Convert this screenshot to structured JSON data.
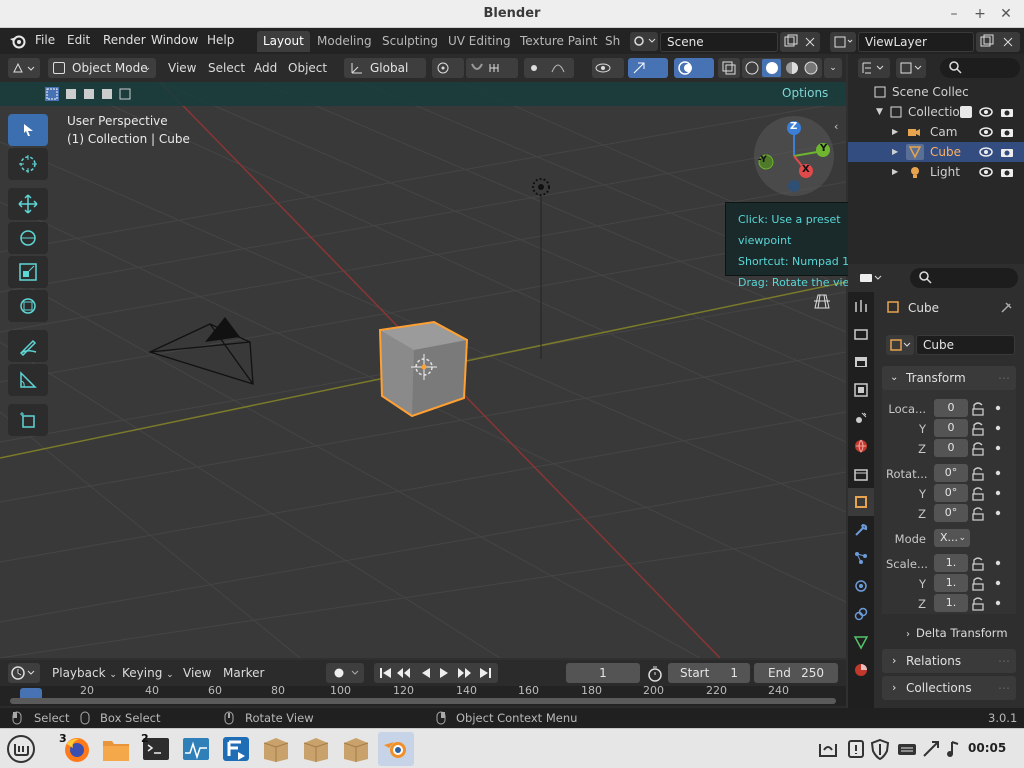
{
  "window": {
    "title": "Blender"
  },
  "menu": {
    "file": "File",
    "edit": "Edit",
    "render": "Render",
    "window": "Window",
    "help": "Help"
  },
  "workspaces": [
    "Layout",
    "Modeling",
    "Sculpting",
    "UV Editing",
    "Texture Paint",
    "Sh"
  ],
  "scene": {
    "name": "Scene",
    "view_layer": "ViewLayer"
  },
  "viewport_header": {
    "mode": "Object Mode",
    "view": "View",
    "select": "Select",
    "add": "Add",
    "object": "Object",
    "orientation": "Global",
    "options": "Options"
  },
  "viewport": {
    "perspective": "User Perspective",
    "context": "(1) Collection | Cube",
    "gizmo": {
      "z": "Z",
      "y": "Y",
      "x": "X",
      "neg_y": "-Y"
    }
  },
  "tooltip": {
    "line1": "Click: Use a preset viewpoint",
    "line2": "Shortcut: Numpad 1",
    "line3": "Drag: Rotate the view"
  },
  "outliner": {
    "root": "Scene Collec",
    "collection": "Collectio",
    "items": [
      {
        "label": "Cam",
        "selected": false
      },
      {
        "label": "Cube",
        "selected": true
      },
      {
        "label": "Light",
        "selected": false
      }
    ]
  },
  "properties": {
    "object_name": "Cube",
    "data_name": "Cube",
    "transform": "Transform",
    "location_label": "Loca...",
    "location": {
      "x": "0",
      "y": "0",
      "z": "0"
    },
    "rotation_label": "Rotat...",
    "rotation": {
      "x": "0°",
      "y": "0°",
      "z": "0°"
    },
    "mode_label": "Mode",
    "mode_value": "X...",
    "scale_label": "Scale...",
    "scale": {
      "x": "1.",
      "y": "1.",
      "z": "1."
    },
    "axis_y": "Y",
    "axis_z": "Z",
    "delta_transform": "Delta Transform",
    "relations": "Relations",
    "collections": "Collections"
  },
  "timeline": {
    "playback": "Playback",
    "keying": "Keying",
    "view": "View",
    "marker": "Marker",
    "current_frame": "1",
    "start_label": "Start",
    "start": "1",
    "end_label": "End",
    "end": "250",
    "ticks": [
      "20",
      "40",
      "60",
      "80",
      "100",
      "120",
      "140",
      "160",
      "180",
      "200",
      "220",
      "240"
    ]
  },
  "status": {
    "select": "Select",
    "box_select": "Box Select",
    "rotate_view": "Rotate View",
    "context_menu": "Object Context Menu",
    "version": "3.0.1"
  },
  "taskbar": {
    "badge_firefox": "3",
    "badge_terminal": "2",
    "clock": "00:05"
  },
  "colors": {
    "accent_blue": "#3b6fb0",
    "selection_orange": "#ffa033",
    "tooltip_text": "#59d6d6"
  }
}
